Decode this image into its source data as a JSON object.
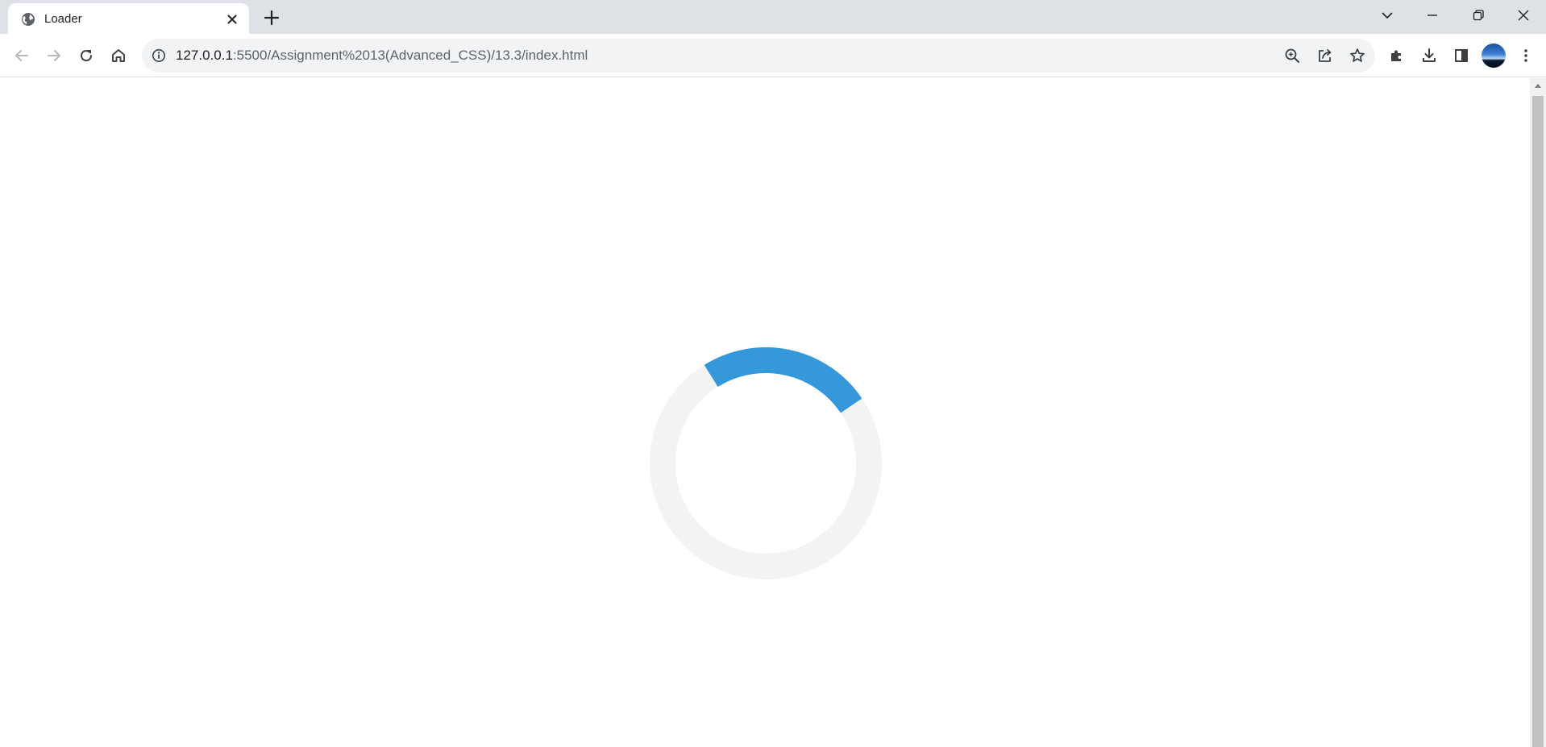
{
  "browser": {
    "tab": {
      "title": "Loader",
      "favicon": "globe-icon"
    },
    "address_bar": {
      "host": "127.0.0.1",
      "path": ":5500/Assignment%2013(Advanced_CSS)/13.3/index.html"
    },
    "icons": {
      "back": "arrow-left-icon",
      "forward": "arrow-right-icon",
      "reload": "reload-icon",
      "home": "home-icon",
      "site_info": "info-icon",
      "zoom": "zoom-in-icon",
      "share": "share-icon",
      "bookmark": "star-icon",
      "extensions": "puzzle-icon",
      "downloads": "download-icon",
      "side_panel": "side-panel-icon",
      "menu": "kebab-menu-icon"
    }
  },
  "page": {
    "loader": {
      "track_color": "#f3f3f3",
      "arc_color": "#3498db"
    }
  }
}
